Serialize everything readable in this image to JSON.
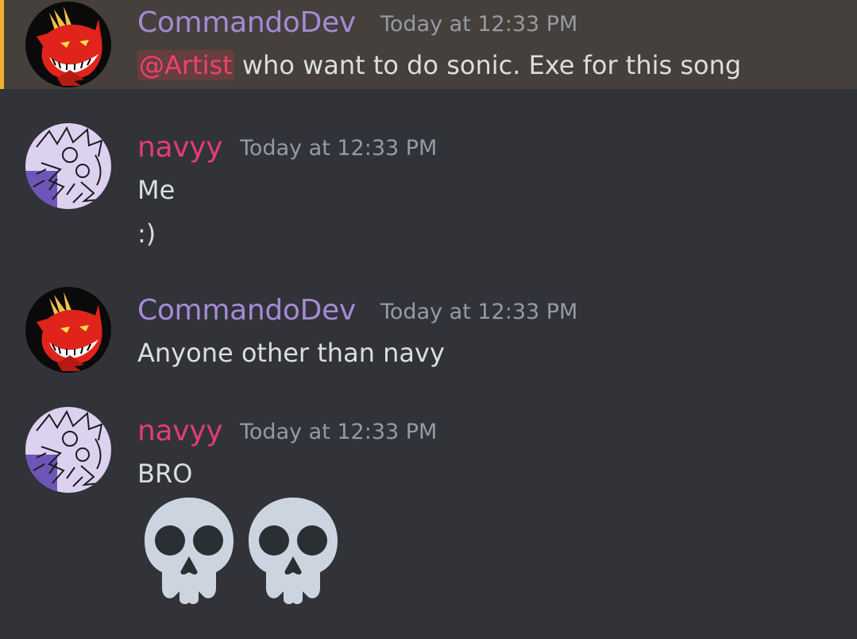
{
  "colors": {
    "background": "#313338",
    "highlight_bg": "#45403b",
    "highlight_bar": "#f0b132",
    "commando_name": "#a68ad6",
    "navyy_name": "#e23d72",
    "mention": "#f23f75",
    "timestamp": "#949ba4",
    "text": "#dbdee1"
  },
  "messages": [
    {
      "author": "CommandoDev",
      "avatar_icon": "red-demon-avatar-icon",
      "timestamp": "Today at 12:33 PM",
      "mention": "@Artist",
      "text": " who want to do sonic. Exe for this song"
    },
    {
      "author": "navyy",
      "avatar_icon": "sketch-avatar-icon",
      "timestamp": "Today at 12:33 PM",
      "lines": [
        "Me",
        ":)"
      ]
    },
    {
      "author": "CommandoDev",
      "avatar_icon": "red-demon-avatar-icon",
      "timestamp": "Today at 12:33 PM",
      "text": "Anyone other than navy"
    },
    {
      "author": "navyy",
      "avatar_icon": "sketch-avatar-icon",
      "timestamp": "Today at 12:33 PM",
      "text": "BRO",
      "emoji": [
        "skull-emoji",
        "skull-emoji"
      ]
    }
  ]
}
